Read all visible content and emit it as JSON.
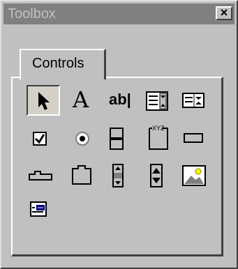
{
  "window": {
    "title": "Toolbox",
    "close_label": "×"
  },
  "tabs": [
    {
      "label": "Controls"
    }
  ],
  "tools": [
    {
      "name": "select-objects",
      "icon": "arrow-pointer-icon",
      "selected": true
    },
    {
      "name": "label",
      "icon": "label-a-icon",
      "glyph": "A"
    },
    {
      "name": "textbox",
      "icon": "textbox-ab-icon",
      "glyph": "ab|"
    },
    {
      "name": "combobox",
      "icon": "combobox-icon"
    },
    {
      "name": "listbox",
      "icon": "listbox-icon"
    },
    {
      "name": "checkbox",
      "icon": "checkbox-icon"
    },
    {
      "name": "option-button",
      "icon": "option-button-icon"
    },
    {
      "name": "toggle-button",
      "icon": "toggle-button-icon"
    },
    {
      "name": "frame",
      "icon": "frame-icon",
      "glyph": "XYZ"
    },
    {
      "name": "command-button",
      "icon": "command-button-icon"
    },
    {
      "name": "tabstrip",
      "icon": "tabstrip-icon"
    },
    {
      "name": "multipage",
      "icon": "multipage-icon"
    },
    {
      "name": "scrollbar",
      "icon": "scrollbar-icon"
    },
    {
      "name": "spin-button",
      "icon": "spin-button-icon"
    },
    {
      "name": "image",
      "icon": "image-icon"
    },
    {
      "name": "refedit",
      "icon": "refedit-icon"
    }
  ]
}
